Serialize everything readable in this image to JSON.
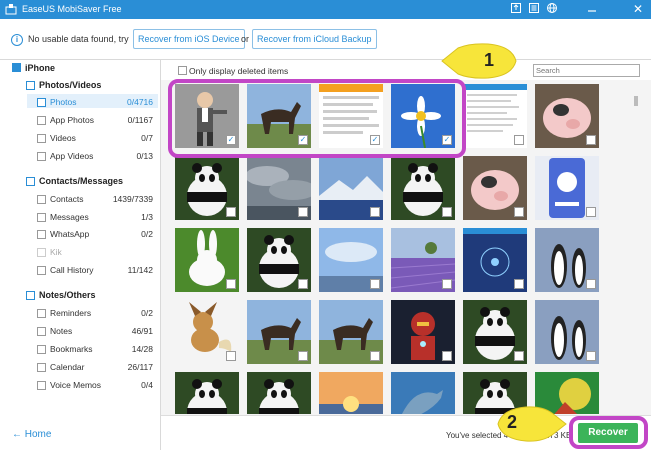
{
  "app": {
    "title": "EaseUS MobiSaver Free"
  },
  "titlebar_controls": [
    "export-icon",
    "menu-icon",
    "globe-icon",
    "minimize-icon",
    "close-icon"
  ],
  "info": {
    "message": "No usable data found, try",
    "btn_ios": "Recover from iOS Device",
    "or": "or",
    "btn_icloud": "Recover from iCloud Backup"
  },
  "sidebar": {
    "device": "iPhone",
    "sections": [
      {
        "title": "Photos/Videos",
        "icon": "photo-icon",
        "items": [
          {
            "label": "Photos",
            "count": "0/4716",
            "selected": true
          },
          {
            "label": "App Photos",
            "count": "0/1167"
          },
          {
            "label": "Videos",
            "count": "0/7"
          },
          {
            "label": "App Videos",
            "count": "0/13"
          }
        ]
      },
      {
        "title": "Contacts/Messages",
        "icon": "contacts-icon",
        "items": [
          {
            "label": "Contacts",
            "count": "1439/7339"
          },
          {
            "label": "Messages",
            "count": "1/3"
          },
          {
            "label": "WhatsApp",
            "count": "0/2"
          },
          {
            "label": "Kik",
            "count": "",
            "dim": true
          },
          {
            "label": "Call History",
            "count": "11/142"
          }
        ]
      },
      {
        "title": "Notes/Others",
        "icon": "notes-icon",
        "items": [
          {
            "label": "Reminders",
            "count": "0/2"
          },
          {
            "label": "Notes",
            "count": "46/91"
          },
          {
            "label": "Bookmarks",
            "count": "14/28"
          },
          {
            "label": "Calendar",
            "count": "26/117"
          },
          {
            "label": "Voice Memos",
            "count": "0/4"
          }
        ]
      }
    ],
    "home": "← Home"
  },
  "main": {
    "filter_label": "Only display deleted items",
    "search_placeholder": "Search",
    "selected_text": "You've selected 4 items, 664.73 KB",
    "recover_label": "Recover"
  },
  "thumbnails": [
    [
      "man",
      "horse",
      "doc",
      "daisy",
      "doc2",
      "pig"
    ],
    [
      "panda",
      "clouds",
      "mountain",
      "panda",
      "pig",
      "app"
    ],
    [
      "rabbit",
      "panda",
      "sky",
      "lavender",
      "app2",
      "penguin"
    ],
    [
      "fox",
      "horse",
      "horse",
      "ironman",
      "panda",
      "penguin"
    ],
    [
      "panda",
      "panda",
      "sunset",
      "dolphin",
      "panda",
      "abstract"
    ]
  ],
  "checked": [
    [
      true,
      true,
      true,
      true,
      false,
      false
    ]
  ],
  "annotations": {
    "step1": "1",
    "step2": "2"
  },
  "colors": {
    "accent": "#2a8ed6",
    "recover": "#3cb45a",
    "highlight": "#c246c6",
    "callout": "#f7e53a"
  }
}
